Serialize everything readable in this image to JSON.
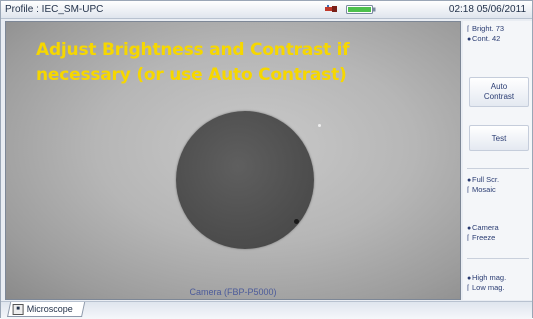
{
  "status_bar": {
    "profile": "Profile : IEC_SM-UPC",
    "usb_icon": "usb-icon",
    "battery_icon": "battery-icon",
    "datetime": "02:18 05/06/2011"
  },
  "viewport": {
    "instruction": "Adjust Brightness and Contrast if necessary (or use Auto Contrast)",
    "source_label": "Camera (FBP-P5000)",
    "instruction_color": "#f6d700"
  },
  "side_panel": {
    "brightness": "Bright. 73",
    "contrast": "Cont. 42",
    "auto_contrast": "Auto Contrast",
    "test": "Test",
    "display_options": [
      "Full Scr.",
      "Mosaic"
    ],
    "source_options": [
      "Camera",
      "Freeze"
    ],
    "magnification_options": [
      "High mag.",
      "Low mag."
    ],
    "selected_display": "Full Scr.",
    "selected_source": "Camera",
    "selected_magnification": "High mag."
  },
  "tabs": {
    "microscope": "Microscope"
  }
}
